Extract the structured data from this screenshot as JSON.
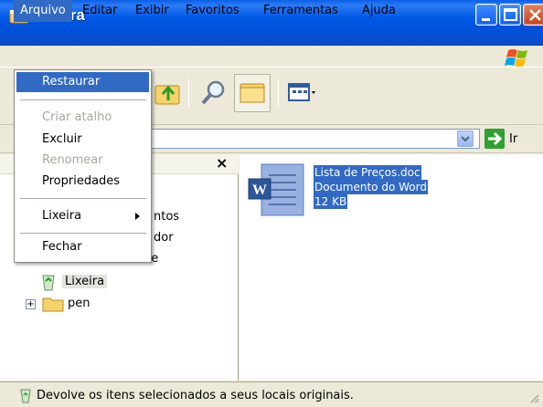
{
  "window": {
    "title": "Lixeira",
    "title_icon": "recycle-bin-icon"
  },
  "menubar": {
    "items": [
      "Arquivo",
      "Editar",
      "Exibir",
      "Favoritos",
      "Ferramentas",
      "Ajuda"
    ],
    "active": "Arquivo"
  },
  "file_menu": {
    "items": [
      {
        "label": "Restaurar",
        "state": "highlighted"
      },
      {
        "label": "Criar atalho",
        "state": "disabled"
      },
      {
        "label": "Excluir",
        "state": "enabled"
      },
      {
        "label": "Renomear",
        "state": "disabled"
      },
      {
        "label": "Propriedades",
        "state": "enabled"
      },
      {
        "label": "Lixeira",
        "state": "enabled",
        "submenu": true
      },
      {
        "label": "Fechar",
        "state": "enabled"
      }
    ]
  },
  "toolbar": {
    "icons": [
      "up-folder-icon",
      "search-icon",
      "folders-icon",
      "views-icon"
    ]
  },
  "address": {
    "go_label": "Ir"
  },
  "tree": {
    "items": [
      {
        "label": "ntos",
        "icon": "documents-icon"
      },
      {
        "label": "dor",
        "icon": "computer-icon"
      },
      {
        "label": "Meus locais de rede",
        "icon": "network-icon"
      },
      {
        "label": "Lixeira",
        "icon": "recycle-bin-icon",
        "selected": true
      },
      {
        "label": "pen",
        "icon": "folder-icon",
        "expandable": true
      }
    ],
    "close_symbol": "×"
  },
  "files": [
    {
      "name": "Lista de Preços.doc",
      "type": "Documento do Word",
      "size": "12 KB",
      "icon": "word-document-icon",
      "selected": true
    }
  ],
  "status": {
    "text": "Devolve os itens selecionados a seus locais originais."
  },
  "colors": {
    "selection": "#316ac5",
    "titlebar": "#0058e6",
    "chrome": "#ece9d8"
  }
}
